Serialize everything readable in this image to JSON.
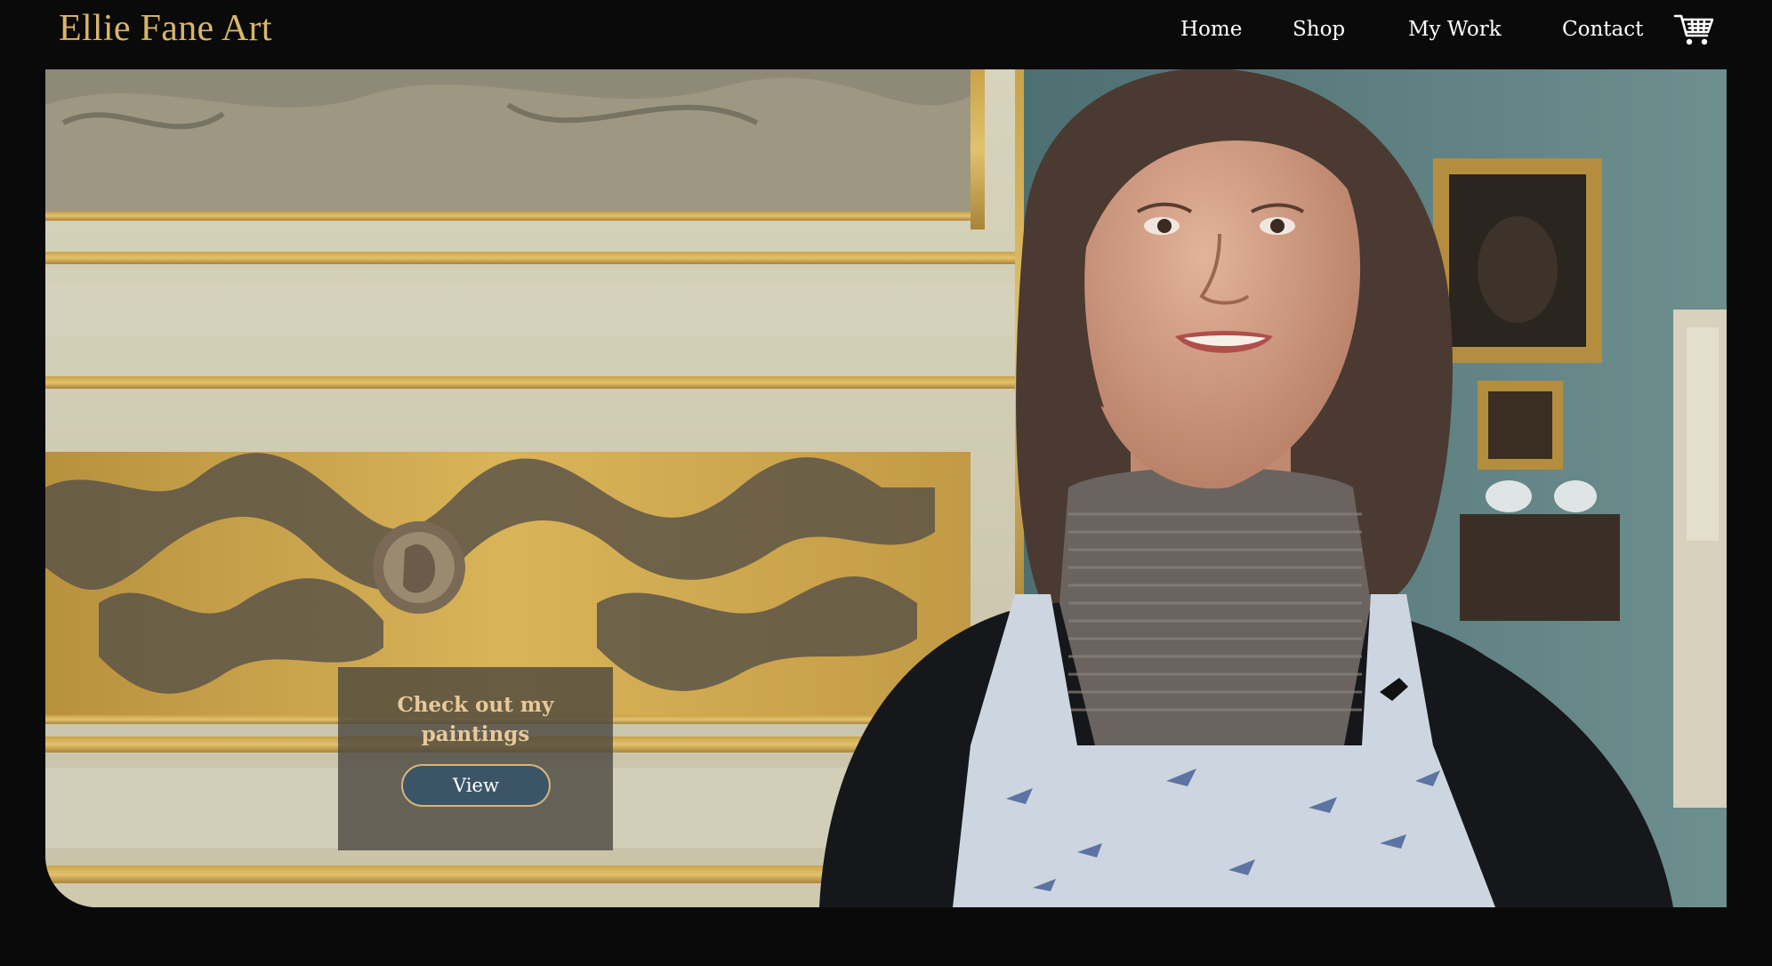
{
  "header": {
    "logo": "Ellie Fane Art",
    "nav": [
      {
        "label": "Home"
      },
      {
        "label": "Shop"
      },
      {
        "label": "My Work"
      },
      {
        "label": "Contact"
      }
    ],
    "cart_icon": "shopping-cart-icon"
  },
  "hero": {
    "image": "artist-portrait-photo",
    "cta": {
      "heading": "Check out my\npaintings",
      "button_label": "View"
    }
  },
  "colors": {
    "background": "#0a0a0a",
    "logo": "#d9b56a",
    "cta_heading": "#e7c99a",
    "button_fill": "#3b5567",
    "button_border": "#d7b47a"
  }
}
